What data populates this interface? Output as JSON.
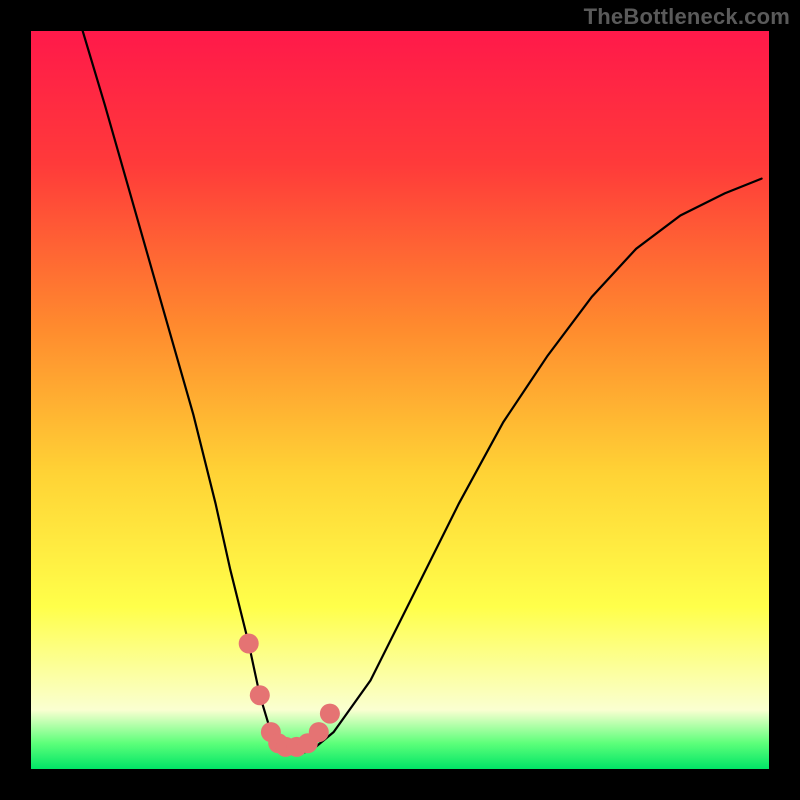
{
  "watermark": "TheBottleneck.com",
  "colors": {
    "frame": "#000000",
    "curve": "#000000",
    "marker": "#e57373",
    "gradient_stops": [
      {
        "offset": 0.0,
        "color": "#ff194a"
      },
      {
        "offset": 0.18,
        "color": "#ff3a3a"
      },
      {
        "offset": 0.4,
        "color": "#ff8a2e"
      },
      {
        "offset": 0.6,
        "color": "#ffd335"
      },
      {
        "offset": 0.78,
        "color": "#ffff4a"
      },
      {
        "offset": 0.92,
        "color": "#faffd1"
      },
      {
        "offset": 0.965,
        "color": "#5dff7a"
      },
      {
        "offset": 1.0,
        "color": "#00e566"
      }
    ]
  },
  "chart_data": {
    "type": "line",
    "title": "",
    "xlabel": "",
    "ylabel": "",
    "xlim": [
      0,
      100
    ],
    "ylim": [
      0,
      100
    ],
    "note": "No numeric axes are shown; values are proportional screen coordinates (percent of plot area). Higher y = higher on the plot. The curve is a V-shape with a rounded minimum.",
    "series": [
      {
        "name": "bottleneck-curve",
        "x": [
          7.0,
          10.0,
          14.0,
          18.0,
          22.0,
          25.0,
          27.0,
          29.5,
          31.0,
          32.5,
          34.0,
          36.0,
          38.0,
          41.0,
          46.0,
          52.0,
          58.0,
          64.0,
          70.0,
          76.0,
          82.0,
          88.0,
          94.0,
          99.0
        ],
        "y": [
          100.0,
          90.0,
          76.0,
          62.0,
          48.0,
          36.0,
          27.0,
          17.0,
          10.0,
          5.0,
          2.5,
          2.0,
          2.5,
          5.0,
          12.0,
          24.0,
          36.0,
          47.0,
          56.0,
          64.0,
          70.5,
          75.0,
          78.0,
          80.0
        ]
      },
      {
        "name": "highlighted-minimum-band",
        "x": [
          29.5,
          31.0,
          32.5,
          33.5,
          34.5,
          36.0,
          37.5,
          39.0,
          40.5
        ],
        "y": [
          17.0,
          10.0,
          5.0,
          3.5,
          3.0,
          3.0,
          3.5,
          5.0,
          7.5
        ]
      }
    ]
  }
}
